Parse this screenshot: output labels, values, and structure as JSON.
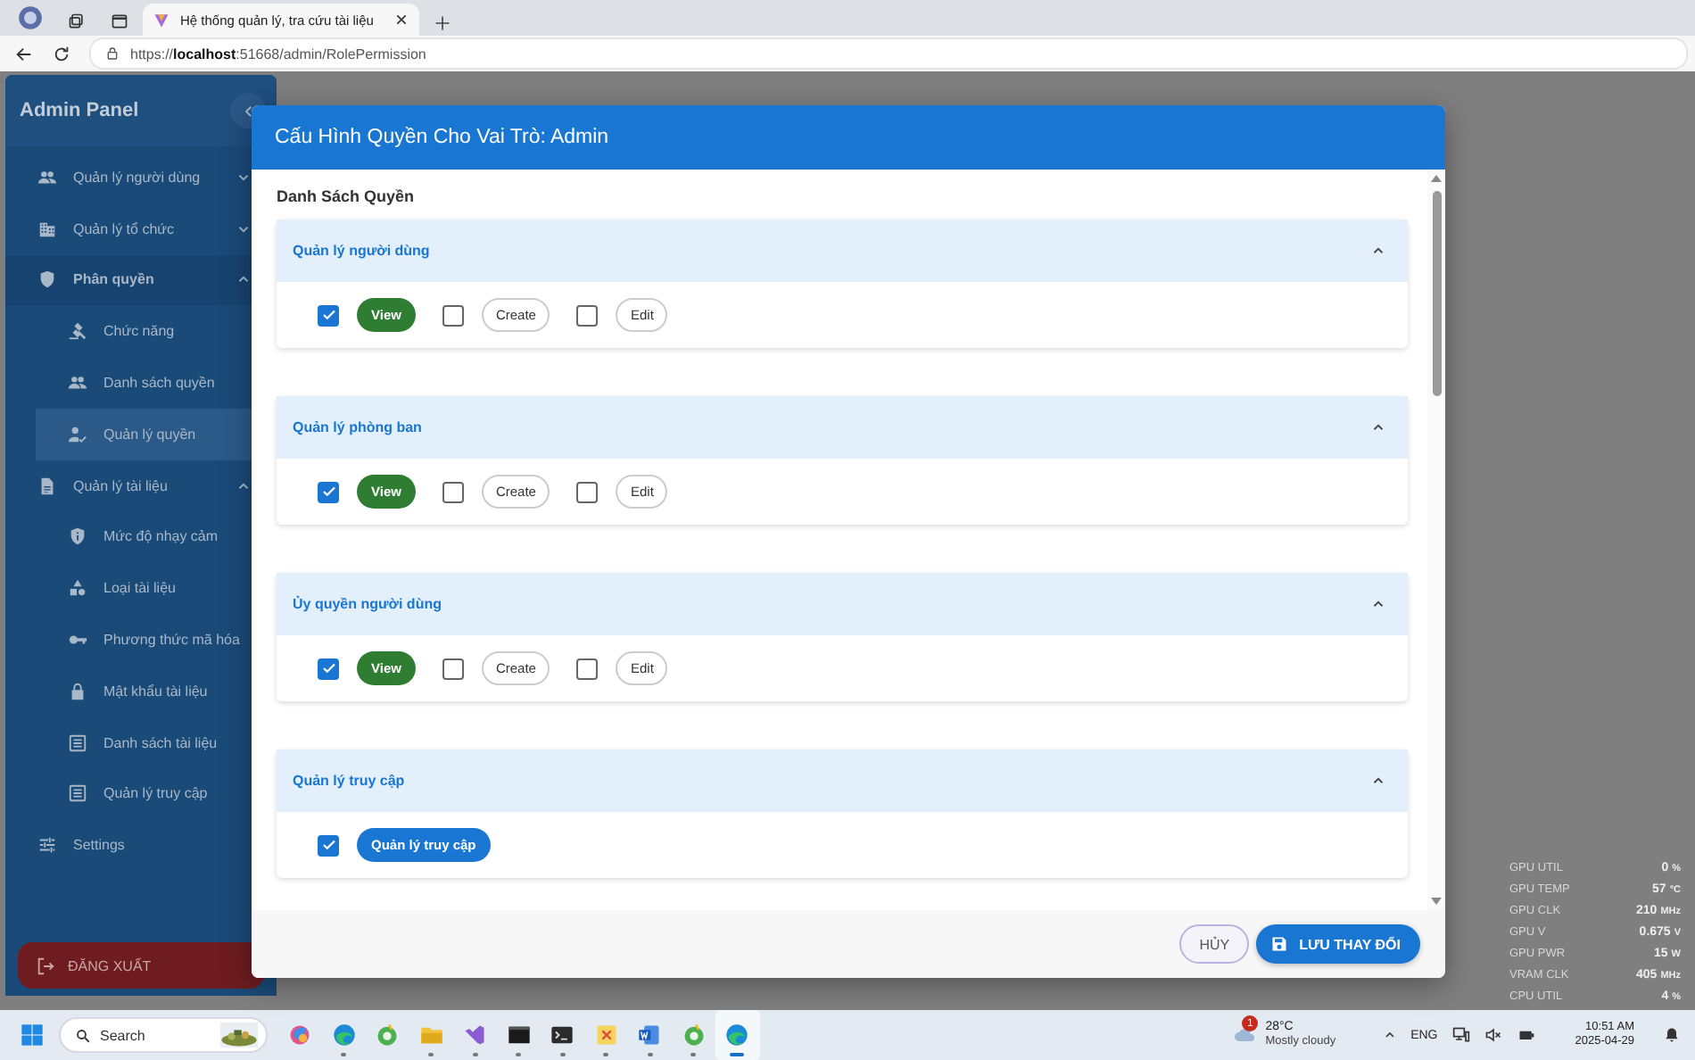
{
  "browser": {
    "tab_title": "Hệ thống quản lý, tra cứu tài liệu",
    "url": "https://**localhost**:51668/admin/RolePermission"
  },
  "sidebar": {
    "title": "Admin Panel",
    "items": [
      {
        "label": "Quản lý người dùng",
        "selected": false,
        "expanded": false
      },
      {
        "label": "Quản lý tổ chức",
        "selected": false,
        "expanded": false
      },
      {
        "label": "Phân quyền",
        "selected": false,
        "expanded": true,
        "children": [
          {
            "label": "Chức năng",
            "selected": false
          },
          {
            "label": "Danh sách quyền",
            "selected": false
          },
          {
            "label": "Quản lý quyền",
            "selected": true
          }
        ]
      },
      {
        "label": "Quản lý tài liệu",
        "selected": false,
        "expanded": true,
        "children": [
          {
            "label": "Mức độ nhạy cảm",
            "selected": false
          },
          {
            "label": "Loại tài liệu",
            "selected": false
          },
          {
            "label": "Phương thức mã hóa",
            "selected": false
          },
          {
            "label": "Mật khẩu tài liệu",
            "selected": false
          },
          {
            "label": "Danh sách tài liệu",
            "selected": false
          },
          {
            "label": "Quản lý truy cập",
            "selected": false
          }
        ]
      },
      {
        "label": "Settings",
        "selected": false
      }
    ],
    "logout": "ĐĂNG XUẤT"
  },
  "dialog": {
    "title": "Cấu Hình Quyền Cho Vai Trò: Admin",
    "section_title": "Danh Sách Quyền",
    "groups": [
      {
        "name": "Quản lý người dùng",
        "expanded": true,
        "permissions": [
          {
            "label": "View",
            "checked": true,
            "color": "#2e7d32"
          },
          {
            "label": "Create",
            "checked": false
          },
          {
            "label": "Edit",
            "checked": false
          }
        ]
      },
      {
        "name": "Quản lý phòng ban",
        "expanded": true,
        "permissions": [
          {
            "label": "View",
            "checked": true,
            "color": "#2e7d32"
          },
          {
            "label": "Create",
            "checked": false
          },
          {
            "label": "Edit",
            "checked": false
          }
        ]
      },
      {
        "name": "Ủy quyền người dùng",
        "expanded": true,
        "permissions": [
          {
            "label": "View",
            "checked": true,
            "color": "#2e7d32"
          },
          {
            "label": "Create",
            "checked": false
          },
          {
            "label": "Edit",
            "checked": false
          }
        ]
      },
      {
        "name": "Quản lý truy cập",
        "expanded": true,
        "permissions": [
          {
            "label": "Quản lý truy cập",
            "checked": true,
            "color": "#1976d2"
          }
        ]
      }
    ],
    "buttons": [
      {
        "label": "HỦY",
        "kind": "outlined"
      },
      {
        "label": "LƯU THAY ĐỔI",
        "kind": "primary"
      }
    ]
  },
  "gpu_overlay": [
    {
      "label": "GPU UTIL",
      "value": "0",
      "unit": "%"
    },
    {
      "label": "GPU TEMP",
      "value": "57",
      "unit": "°C"
    },
    {
      "label": "GPU CLK",
      "value": "210",
      "unit": "MHz"
    },
    {
      "label": "GPU V",
      "value": "0.675",
      "unit": "V"
    },
    {
      "label": "GPU PWR",
      "value": "15",
      "unit": "W"
    },
    {
      "label": "VRAM CLK",
      "value": "405",
      "unit": "MHz"
    },
    {
      "label": "CPU UTIL",
      "value": "4",
      "unit": "%"
    }
  ],
  "taskbar": {
    "search": {
      "placeholder": "Search"
    },
    "apps": [
      {
        "running": false,
        "selected": false
      },
      {
        "running": true,
        "selected": false
      },
      {
        "running": false,
        "selected": false
      },
      {
        "running": true,
        "selected": false
      },
      {
        "running": true,
        "selected": false
      },
      {
        "running": true,
        "selected": false
      },
      {
        "running": true,
        "selected": false
      },
      {
        "running": true,
        "selected": false
      },
      {
        "running": true,
        "selected": false
      },
      {
        "running": true,
        "selected": false
      },
      {
        "running": true,
        "selected": true
      }
    ],
    "weather": {
      "badge": "1",
      "temperature": "28°C",
      "condition": "Mostly cloudy"
    },
    "language": "ENG",
    "time": "10:51 AM",
    "date": "2025-04-29"
  }
}
